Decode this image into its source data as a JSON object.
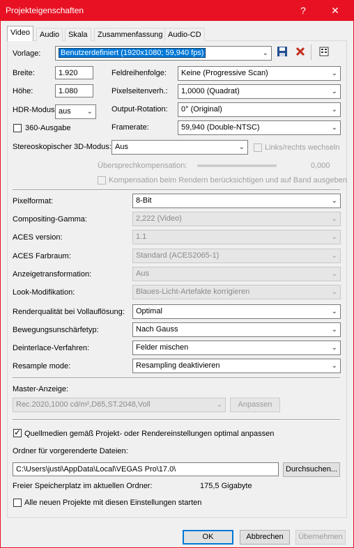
{
  "window": {
    "title": "Projekteigenschaften",
    "help_label": "?",
    "close_label": "✕"
  },
  "tabs": [
    {
      "label": "Video",
      "active": true
    },
    {
      "label": "Audio"
    },
    {
      "label": "Skala"
    },
    {
      "label": "Zusammenfassung"
    },
    {
      "label": "Audio-CD"
    }
  ],
  "template": {
    "label": "Vorlage:",
    "value": "Benutzerdefiniert (1920x1080; 59,940 fps)"
  },
  "fields": {
    "width": {
      "label": "Breite:",
      "value": "1.920"
    },
    "height": {
      "label": "Höhe:",
      "value": "1.080"
    },
    "hdr": {
      "label": "HDR-Modus:",
      "value": "aus"
    },
    "output360": {
      "label": "360-Ausgabe",
      "checked": false
    },
    "field_order": {
      "label": "Feldreihenfolge:",
      "value": "Keine (Progressive Scan)"
    },
    "pixel_aspect": {
      "label": "Pixelseitenverh.:",
      "value": "1,0000 (Quadrat)"
    },
    "output_rotation": {
      "label": "Output-Rotation:",
      "value": "0° (Original)"
    },
    "framerate": {
      "label": "Framerate:",
      "value": "59,940 (Double-NTSC)"
    },
    "stereo3d": {
      "label": "Stereoskopischer 3D-Modus:",
      "value": "Aus"
    },
    "swap_lr": {
      "label": "Links/rechts wechseln",
      "checked": false
    },
    "crosstalk": {
      "label": "Übersprechkompensation:",
      "value": "0,000"
    },
    "crosstalk_render": {
      "label": "Kompensation beim Rendern berücksichtigen und auf Band ausgeben",
      "checked": false
    }
  },
  "settings": [
    {
      "label": "Pixelformat:",
      "value": "8-Bit",
      "disabled": false
    },
    {
      "label": "Compositing-Gamma:",
      "value": "2,222 (Video)",
      "disabled": true
    },
    {
      "label": "ACES version:",
      "value": "1.1",
      "disabled": true
    },
    {
      "label": "ACES Farbraum:",
      "value": "Standard (ACES2065-1)",
      "disabled": true
    },
    {
      "label": "Anzeigetransformation:",
      "value": "Aus",
      "disabled": true
    },
    {
      "label": "Look-Modifikation:",
      "value": "Blaues-Licht-Artefakte korrigieren",
      "disabled": true
    },
    {
      "label": "Renderqualität bei Vollauflösung:",
      "value": "Optimal",
      "disabled": false
    },
    {
      "label": "Bewegungsunschärfetyp:",
      "value": "Nach Gauss",
      "disabled": false
    },
    {
      "label": "Deinterlace-Verfahren:",
      "value": "Felder mischen",
      "disabled": false
    },
    {
      "label": "Resample mode:",
      "value": "Resampling deaktivieren",
      "disabled": false
    }
  ],
  "master": {
    "label": "Master-Anzeige:",
    "value": "Rec.2020,1000 cd/m²,D65,ST.2048,Voll",
    "adjust_label": "Anpassen"
  },
  "source_media": {
    "label": "Quellmedien gemäß Projekt- oder Rendereinstellungen optimal anpassen",
    "checked": true
  },
  "prerender": {
    "label": "Ordner für vorgerenderte Dateien:",
    "path": "C:\\Users\\justi\\AppData\\Local\\VEGAS Pro\\17.0\\",
    "browse_label": "Durchsuchen...",
    "free_label": "Freier Speicherplatz im aktuellen Ordner:",
    "free_value": "175,5 Gigabyte"
  },
  "start_all": {
    "label": "Alle neuen Projekte mit diesen Einstellungen starten",
    "checked": false
  },
  "buttons": {
    "ok": "OK",
    "cancel": "Abbrechen",
    "apply": "Übernehmen"
  },
  "colors": {
    "titlebar": "#e81123",
    "accent": "#0078d7"
  }
}
